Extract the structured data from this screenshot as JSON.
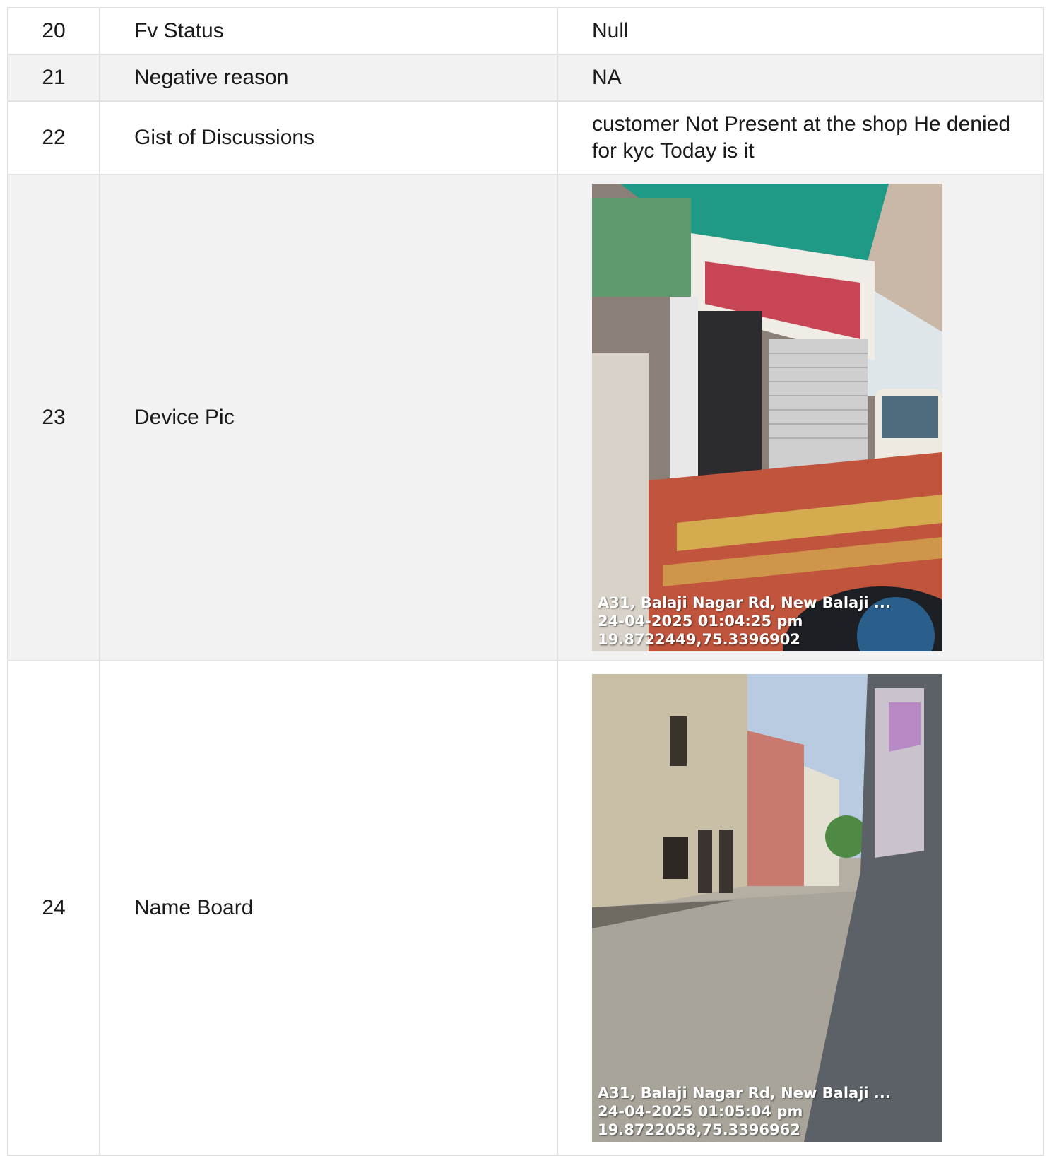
{
  "rows": [
    {
      "num": "20",
      "label": "Fv Status",
      "value": "Null"
    },
    {
      "num": "21",
      "label": "Negative reason",
      "value": "NA"
    },
    {
      "num": "22",
      "label": "Gist of Discussions",
      "value": "customer Not Present at the shop He denied for kyc Today is it"
    },
    {
      "num": "23",
      "label": "Device Pic",
      "photo": {
        "subject": "shop-front-photo",
        "address": "A31, Balaji Nagar Rd, New Balaji ...",
        "datetime": "24-04-2025 01:04:25 pm",
        "coords": "19.8722449,75.3396902"
      }
    },
    {
      "num": "24",
      "label": "Name Board",
      "photo": {
        "subject": "street-photo",
        "address": "A31, Balaji Nagar Rd, New Balaji ...",
        "datetime": "24-04-2025 01:05:04 pm",
        "coords": "19.8722058,75.3396962"
      }
    }
  ]
}
